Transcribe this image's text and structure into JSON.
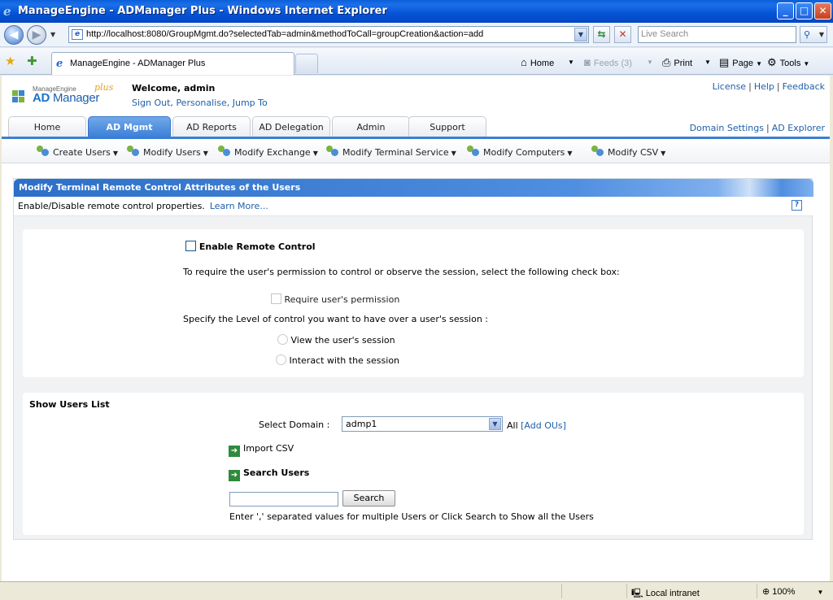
{
  "window": {
    "title": "ManageEngine - ADManager Plus - Windows Internet Explorer",
    "minimize": "_",
    "maximize": "□",
    "close": "✕"
  },
  "address_bar": {
    "url": "http://localhost:8080/GroupMgmt.do?selectedTab=admin&methodToCall=groupCreation&action=add",
    "search_placeholder": "Live Search"
  },
  "browser_tab": {
    "label": "ManageEngine - ADManager Plus"
  },
  "commands": {
    "home": "Home",
    "feeds": "Feeds (3)",
    "print": "Print",
    "page": "Page",
    "tools": "Tools"
  },
  "brand": {
    "vendor": "ManageEngine",
    "product_a": "AD",
    "product_b": "Manager",
    "plus": "plus"
  },
  "header": {
    "welcome": "Welcome,  admin",
    "sign_out": "Sign Out,",
    "personalise": "Personalise,",
    "jump_to": "Jump To",
    "license": "License",
    "help": "Help",
    "feedback": "Feedback",
    "sep": "|"
  },
  "tabs": [
    {
      "label": "Home"
    },
    {
      "label": "AD Mgmt"
    },
    {
      "label": "AD Reports"
    },
    {
      "label": "AD Delegation"
    },
    {
      "label": "Admin"
    },
    {
      "label": "Support"
    }
  ],
  "right_links": {
    "domain_settings": "Domain Settings",
    "ad_explorer": "AD Explorer"
  },
  "submenu": [
    {
      "label": "Create Users"
    },
    {
      "label": "Modify Users"
    },
    {
      "label": "Modify Exchange"
    },
    {
      "label": "Modify Terminal Service"
    },
    {
      "label": "Modify Computers"
    },
    {
      "label": "Modify CSV"
    }
  ],
  "panel": {
    "title": "Modify Terminal Remote Control Attributes of the Users",
    "description": "Enable/Disable remote control properties.",
    "learn_more": "Learn More...",
    "help_icon": "?"
  },
  "remote_control": {
    "enable_label": "Enable Remote Control",
    "permission_text": "To require the user's permission to control or observe the session, select the following check box:",
    "require_permission_label": "Require user's permission",
    "level_text": "Specify the Level of control you want to have over a user's session :",
    "view_label": "View the user's session",
    "interact_label": "Interact with the session"
  },
  "users_list": {
    "heading": "Show Users List",
    "domain_label": "Select Domain :",
    "domain_value": "admp1",
    "all_text": "All",
    "add_ous": "[Add OUs]",
    "import_csv": "Import CSV",
    "search_users": "Search Users",
    "search_button": "Search",
    "search_value": "",
    "hint": "Enter ',' separated values for multiple Users or Click Search to Show all the Users"
  },
  "status_bar": {
    "zone": "Local intranet",
    "zoom": "100%"
  }
}
